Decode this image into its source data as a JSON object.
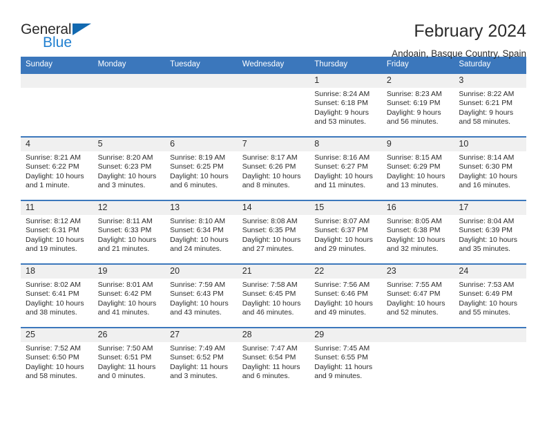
{
  "logo": {
    "word_top": "General",
    "word_bottom": "Blue",
    "triangle_icon": "blue-triangle-icon",
    "color_blue": "#1f7fd0",
    "color_triangle": "#1269b0"
  },
  "header": {
    "title": "February 2024",
    "subtitle": "Andoain, Basque Country, Spain"
  },
  "theme": {
    "header_bg": "#3b77bc",
    "daynum_bg": "#f0f0f0",
    "text": "#2b2b2b"
  },
  "calendar": {
    "weekday_headers": [
      "Sunday",
      "Monday",
      "Tuesday",
      "Wednesday",
      "Thursday",
      "Friday",
      "Saturday"
    ],
    "weeks": [
      [
        {
          "day": "",
          "sunrise": "",
          "sunset": "",
          "daylight": "",
          "empty": true
        },
        {
          "day": "",
          "sunrise": "",
          "sunset": "",
          "daylight": "",
          "empty": true
        },
        {
          "day": "",
          "sunrise": "",
          "sunset": "",
          "daylight": "",
          "empty": true
        },
        {
          "day": "",
          "sunrise": "",
          "sunset": "",
          "daylight": "",
          "empty": true
        },
        {
          "day": "1",
          "sunrise": "Sunrise: 8:24 AM",
          "sunset": "Sunset: 6:18 PM",
          "daylight": "Daylight: 9 hours and 53 minutes.",
          "empty": false
        },
        {
          "day": "2",
          "sunrise": "Sunrise: 8:23 AM",
          "sunset": "Sunset: 6:19 PM",
          "daylight": "Daylight: 9 hours and 56 minutes.",
          "empty": false
        },
        {
          "day": "3",
          "sunrise": "Sunrise: 8:22 AM",
          "sunset": "Sunset: 6:21 PM",
          "daylight": "Daylight: 9 hours and 58 minutes.",
          "empty": false
        }
      ],
      [
        {
          "day": "4",
          "sunrise": "Sunrise: 8:21 AM",
          "sunset": "Sunset: 6:22 PM",
          "daylight": "Daylight: 10 hours and 1 minute.",
          "empty": false
        },
        {
          "day": "5",
          "sunrise": "Sunrise: 8:20 AM",
          "sunset": "Sunset: 6:23 PM",
          "daylight": "Daylight: 10 hours and 3 minutes.",
          "empty": false
        },
        {
          "day": "6",
          "sunrise": "Sunrise: 8:19 AM",
          "sunset": "Sunset: 6:25 PM",
          "daylight": "Daylight: 10 hours and 6 minutes.",
          "empty": false
        },
        {
          "day": "7",
          "sunrise": "Sunrise: 8:17 AM",
          "sunset": "Sunset: 6:26 PM",
          "daylight": "Daylight: 10 hours and 8 minutes.",
          "empty": false
        },
        {
          "day": "8",
          "sunrise": "Sunrise: 8:16 AM",
          "sunset": "Sunset: 6:27 PM",
          "daylight": "Daylight: 10 hours and 11 minutes.",
          "empty": false
        },
        {
          "day": "9",
          "sunrise": "Sunrise: 8:15 AM",
          "sunset": "Sunset: 6:29 PM",
          "daylight": "Daylight: 10 hours and 13 minutes.",
          "empty": false
        },
        {
          "day": "10",
          "sunrise": "Sunrise: 8:14 AM",
          "sunset": "Sunset: 6:30 PM",
          "daylight": "Daylight: 10 hours and 16 minutes.",
          "empty": false
        }
      ],
      [
        {
          "day": "11",
          "sunrise": "Sunrise: 8:12 AM",
          "sunset": "Sunset: 6:31 PM",
          "daylight": "Daylight: 10 hours and 19 minutes.",
          "empty": false
        },
        {
          "day": "12",
          "sunrise": "Sunrise: 8:11 AM",
          "sunset": "Sunset: 6:33 PM",
          "daylight": "Daylight: 10 hours and 21 minutes.",
          "empty": false
        },
        {
          "day": "13",
          "sunrise": "Sunrise: 8:10 AM",
          "sunset": "Sunset: 6:34 PM",
          "daylight": "Daylight: 10 hours and 24 minutes.",
          "empty": false
        },
        {
          "day": "14",
          "sunrise": "Sunrise: 8:08 AM",
          "sunset": "Sunset: 6:35 PM",
          "daylight": "Daylight: 10 hours and 27 minutes.",
          "empty": false
        },
        {
          "day": "15",
          "sunrise": "Sunrise: 8:07 AM",
          "sunset": "Sunset: 6:37 PM",
          "daylight": "Daylight: 10 hours and 29 minutes.",
          "empty": false
        },
        {
          "day": "16",
          "sunrise": "Sunrise: 8:05 AM",
          "sunset": "Sunset: 6:38 PM",
          "daylight": "Daylight: 10 hours and 32 minutes.",
          "empty": false
        },
        {
          "day": "17",
          "sunrise": "Sunrise: 8:04 AM",
          "sunset": "Sunset: 6:39 PM",
          "daylight": "Daylight: 10 hours and 35 minutes.",
          "empty": false
        }
      ],
      [
        {
          "day": "18",
          "sunrise": "Sunrise: 8:02 AM",
          "sunset": "Sunset: 6:41 PM",
          "daylight": "Daylight: 10 hours and 38 minutes.",
          "empty": false
        },
        {
          "day": "19",
          "sunrise": "Sunrise: 8:01 AM",
          "sunset": "Sunset: 6:42 PM",
          "daylight": "Daylight: 10 hours and 41 minutes.",
          "empty": false
        },
        {
          "day": "20",
          "sunrise": "Sunrise: 7:59 AM",
          "sunset": "Sunset: 6:43 PM",
          "daylight": "Daylight: 10 hours and 43 minutes.",
          "empty": false
        },
        {
          "day": "21",
          "sunrise": "Sunrise: 7:58 AM",
          "sunset": "Sunset: 6:45 PM",
          "daylight": "Daylight: 10 hours and 46 minutes.",
          "empty": false
        },
        {
          "day": "22",
          "sunrise": "Sunrise: 7:56 AM",
          "sunset": "Sunset: 6:46 PM",
          "daylight": "Daylight: 10 hours and 49 minutes.",
          "empty": false
        },
        {
          "day": "23",
          "sunrise": "Sunrise: 7:55 AM",
          "sunset": "Sunset: 6:47 PM",
          "daylight": "Daylight: 10 hours and 52 minutes.",
          "empty": false
        },
        {
          "day": "24",
          "sunrise": "Sunrise: 7:53 AM",
          "sunset": "Sunset: 6:49 PM",
          "daylight": "Daylight: 10 hours and 55 minutes.",
          "empty": false
        }
      ],
      [
        {
          "day": "25",
          "sunrise": "Sunrise: 7:52 AM",
          "sunset": "Sunset: 6:50 PM",
          "daylight": "Daylight: 10 hours and 58 minutes.",
          "empty": false
        },
        {
          "day": "26",
          "sunrise": "Sunrise: 7:50 AM",
          "sunset": "Sunset: 6:51 PM",
          "daylight": "Daylight: 11 hours and 0 minutes.",
          "empty": false
        },
        {
          "day": "27",
          "sunrise": "Sunrise: 7:49 AM",
          "sunset": "Sunset: 6:52 PM",
          "daylight": "Daylight: 11 hours and 3 minutes.",
          "empty": false
        },
        {
          "day": "28",
          "sunrise": "Sunrise: 7:47 AM",
          "sunset": "Sunset: 6:54 PM",
          "daylight": "Daylight: 11 hours and 6 minutes.",
          "empty": false
        },
        {
          "day": "29",
          "sunrise": "Sunrise: 7:45 AM",
          "sunset": "Sunset: 6:55 PM",
          "daylight": "Daylight: 11 hours and 9 minutes.",
          "empty": false
        },
        {
          "day": "",
          "sunrise": "",
          "sunset": "",
          "daylight": "",
          "empty": true
        },
        {
          "day": "",
          "sunrise": "",
          "sunset": "",
          "daylight": "",
          "empty": true
        }
      ]
    ]
  }
}
